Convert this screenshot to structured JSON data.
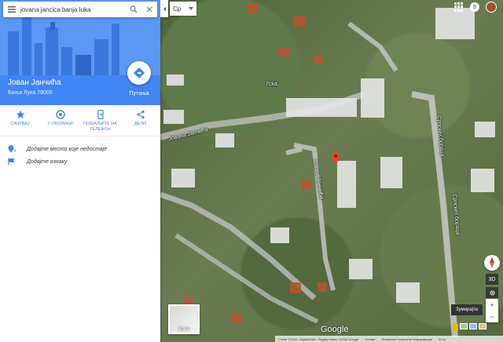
{
  "search": {
    "value": "jovana jancica banja luka"
  },
  "place": {
    "title": "Јован Јанчића",
    "subtitle": "Бања Лука 78000"
  },
  "route": {
    "label": "Путања"
  },
  "actions": [
    {
      "label": "САЧУВАЈ",
      "icon": "star-icon"
    },
    {
      "label": "У ОКОЛИНИ",
      "icon": "nearby-icon"
    },
    {
      "label": "ПОШАЉИТЕ НА ТЕЛЕФОН",
      "icon": "send-to-phone-icon"
    },
    {
      "label": "ДЕЛИ",
      "icon": "share-icon"
    }
  ],
  "list": [
    {
      "text": "Додајте место које недостаје",
      "icon": "add-place-icon"
    },
    {
      "text": "Додајте ознаку",
      "icon": "flag-icon"
    }
  ],
  "language": {
    "value": "Ср"
  },
  "notifications": {
    "count": "5"
  },
  "map": {
    "poi_label": "7cka",
    "street_labels": [
      "Јована Јанчића",
      "Јована Јанчића",
      "Српских бораца",
      "Српских бораца"
    ],
    "layer_label": "Мапа",
    "google": "Google",
    "zoom_out": "Зумирајте",
    "mode_3d": "3D",
    "attribution": [
      "Слике ©2018, DigitalGlobe, Подаци мапе ©2018 Google",
      "Услови",
      "Пошаљите повратне информације",
      "20 m"
    ]
  },
  "colors": {
    "accent": "#4285f4",
    "marker": "#ea4335"
  }
}
